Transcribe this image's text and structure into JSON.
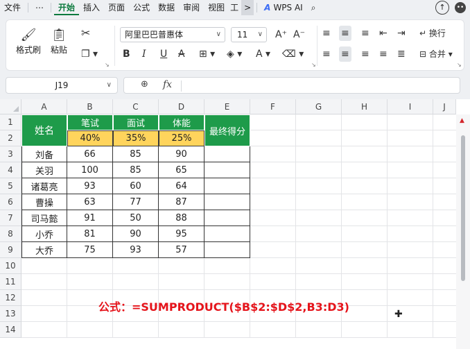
{
  "menubar": {
    "items": [
      "文件",
      "⋯",
      "开始",
      "插入",
      "页面",
      "公式",
      "数据",
      "审阅",
      "视图",
      "工"
    ],
    "active_index": 2,
    "more_label": ">",
    "wps_ai": "WPS AI"
  },
  "ribbon": {
    "format_painter": "格式刷",
    "paste": "粘贴",
    "font_name": "阿里巴巴普惠体",
    "font_size": "11",
    "wrap_text": "换行",
    "merge": "合并",
    "grow_font": "A⁺",
    "shrink_font": "A⁻",
    "bold": "B",
    "italic": "I",
    "underline": "U",
    "strike": "A̶"
  },
  "formula_bar": {
    "name_box": "J19",
    "fx": "fx",
    "content": ""
  },
  "columns": [
    "A",
    "B",
    "C",
    "D",
    "E",
    "F",
    "G",
    "H",
    "I",
    "J"
  ],
  "rows": [
    "1",
    "2",
    "3",
    "4",
    "5",
    "6",
    "7",
    "8",
    "9",
    "10",
    "11",
    "12",
    "13",
    "14"
  ],
  "table": {
    "name_header": "姓名",
    "subjects": [
      "笔试",
      "面试",
      "体能"
    ],
    "weights": [
      "40%",
      "35%",
      "25%"
    ],
    "final_header": "最终得分",
    "records": [
      {
        "name": "刘备",
        "scores": [
          "66",
          "85",
          "90"
        ]
      },
      {
        "name": "关羽",
        "scores": [
          "100",
          "85",
          "65"
        ]
      },
      {
        "name": "诸葛亮",
        "scores": [
          "93",
          "60",
          "64"
        ]
      },
      {
        "name": "曹操",
        "scores": [
          "63",
          "77",
          "87"
        ]
      },
      {
        "name": "司马懿",
        "scores": [
          "91",
          "50",
          "88"
        ]
      },
      {
        "name": "小乔",
        "scores": [
          "81",
          "90",
          "95"
        ]
      },
      {
        "name": "大乔",
        "scores": [
          "75",
          "93",
          "57"
        ]
      }
    ]
  },
  "annotation": "公式：=SUMPRODUCT($B$2:$D$2,B3:D3)",
  "colors": {
    "header_green": "#1e9b4a",
    "weight_yellow": "#ffd45c",
    "annotation_red": "#e5141b",
    "active_tab": "#0b7a3e"
  }
}
